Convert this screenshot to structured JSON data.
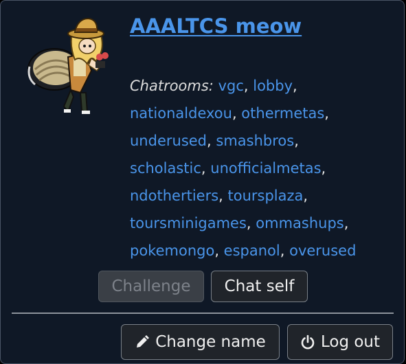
{
  "user": {
    "name": "AAALTCS meow"
  },
  "chatrooms": {
    "label": "Chatrooms:",
    "rooms": [
      "vgc",
      "lobby",
      "nationaldexou",
      "othermetas",
      "underused",
      "smashbros",
      "scholastic",
      "unofficialmetas",
      "ndothertiers",
      "toursplaza",
      "toursminigames",
      "ommashups",
      "pokemongo",
      "espanol",
      "overused"
    ]
  },
  "buttons": {
    "challenge": "Challenge",
    "chat_self": "Chat self",
    "change_name": "Change name",
    "log_out": "Log out"
  },
  "icons": {
    "change_name": "pencil-icon",
    "log_out": "power-icon"
  },
  "colors": {
    "background": "#0f1826",
    "link": "#4a95ea",
    "button_bg": "#20242a",
    "button_disabled_bg": "#3a3f46"
  }
}
